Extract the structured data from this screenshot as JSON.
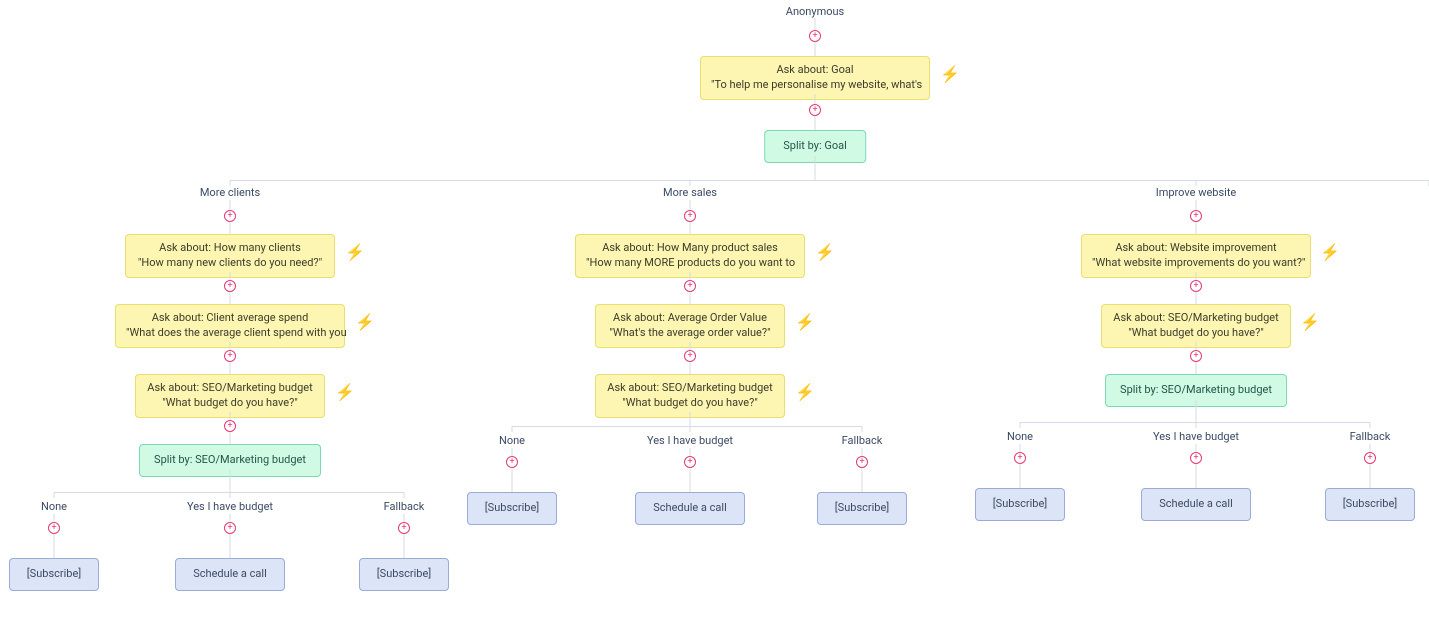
{
  "root_label": "Anonymous",
  "root_ask": {
    "line1": "Ask about: Goal",
    "line2": "\"To help me personalise my website, what's"
  },
  "root_split": "Split by: Goal",
  "branches": [
    {
      "label": "More clients",
      "asks": [
        {
          "line1": "Ask about: How many clients",
          "line2": "\"How many new clients do you need?\""
        },
        {
          "line1": "Ask about: Client average spend",
          "line2": "\"What does the average client spend with you"
        },
        {
          "line1": "Ask about: SEO/Marketing budget",
          "line2": "\"What budget do you have?\""
        }
      ],
      "split": "Split by: SEO/Marketing budget",
      "terminals": [
        {
          "label": "None",
          "node": "[Subscribe]"
        },
        {
          "label": "Yes I have budget",
          "node": "Schedule a call"
        },
        {
          "label": "Fallback",
          "node": "[Subscribe]"
        }
      ]
    },
    {
      "label": "More sales",
      "asks": [
        {
          "line1": "Ask about: How Many product sales",
          "line2": "\"How many MORE products do you want to"
        },
        {
          "line1": "Ask about: Average Order Value",
          "line2": "\"What's the average order value?\""
        },
        {
          "line1": "Ask about: SEO/Marketing budget",
          "line2": "\"What budget do you have?\""
        }
      ],
      "split": null,
      "terminals": [
        {
          "label": "None",
          "node": "[Subscribe]"
        },
        {
          "label": "Yes I have budget",
          "node": "Schedule a call"
        },
        {
          "label": "Fallback",
          "node": "[Subscribe]"
        }
      ]
    },
    {
      "label": "Improve website",
      "asks": [
        {
          "line1": "Ask about: Website improvement",
          "line2": "\"What website improvements do you want?\""
        },
        {
          "line1": "Ask about: SEO/Marketing budget",
          "line2": "\"What budget do you have?\""
        }
      ],
      "split": "Split by: SEO/Marketing budget",
      "terminals": [
        {
          "label": "None",
          "node": "[Subscribe]"
        },
        {
          "label": "Yes I have budget",
          "node": "Schedule a call"
        },
        {
          "label": "Fallback",
          "node": "[Subscribe]"
        }
      ]
    }
  ]
}
